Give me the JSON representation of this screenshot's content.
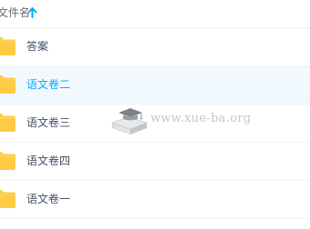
{
  "header": {
    "column_label": "文件名",
    "sort": "ascending"
  },
  "files": [
    {
      "name": "答案",
      "type": "folder"
    },
    {
      "name": "语文卷二",
      "type": "folder",
      "selected": true
    },
    {
      "name": "语文卷三",
      "type": "folder"
    },
    {
      "name": "语文卷四",
      "type": "folder"
    },
    {
      "name": "语文卷一",
      "type": "folder"
    }
  ],
  "watermark": {
    "text": "www.xue-ba.org"
  },
  "colors": {
    "folder": "#ffcb45",
    "accent": "#09aaff",
    "selected_row": "#f1f9fe",
    "text": "#424e67"
  },
  "icons": {
    "folder": "folder-icon",
    "sort": "sort-ascending-icon",
    "watermark_logo": "graduation-cap-book-icon"
  }
}
